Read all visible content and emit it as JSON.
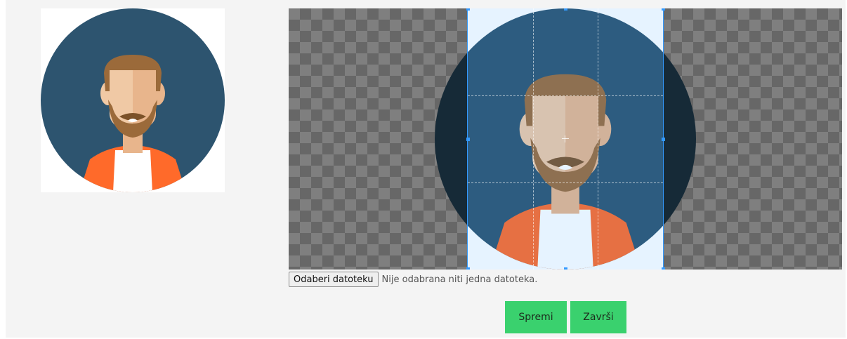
{
  "file_input": {
    "button_label": "Odaberi datoteku",
    "status_text": "Nije odabrana niti jedna datoteka."
  },
  "actions": {
    "save_label": "Spremi",
    "finish_label": "Završi"
  },
  "colors": {
    "accent_button": "#3ad16e",
    "crop_border": "#3399ff",
    "avatar_bg": "#2d546f",
    "hair": "#9b6a3a",
    "jacket": "#ff6a2a"
  }
}
